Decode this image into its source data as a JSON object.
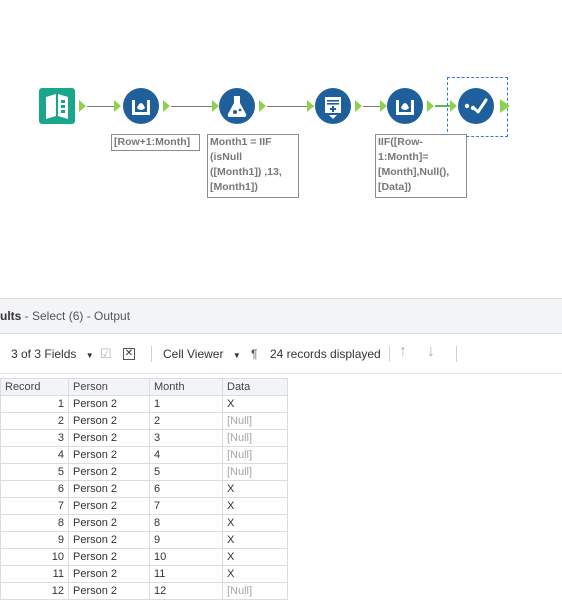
{
  "workflow": {
    "annotations": {
      "multi_row_1": "[Row+1:Month]",
      "formula": "Month1 = IIF\n(isNull\n([Month1]) ,13,\n[Month1])",
      "multi_row_2": "IIF([Row-\n1:Month]=\n[Month],Null(),\n[Data])"
    }
  },
  "results": {
    "title": "ults",
    "subtitle": " - Select (6) - Output"
  },
  "toolbar": {
    "fields_label": "3 of 3 Fields",
    "cell_viewer_label": "Cell Viewer",
    "records_label": "24 records displayed"
  },
  "table": {
    "columns": [
      "Record",
      "Person",
      "Month",
      "Data"
    ],
    "rows": [
      [
        "1",
        "Person 2",
        "1",
        "X"
      ],
      [
        "2",
        "Person 2",
        "2",
        "[Null]"
      ],
      [
        "3",
        "Person 2",
        "3",
        "[Null]"
      ],
      [
        "4",
        "Person 2",
        "4",
        "[Null]"
      ],
      [
        "5",
        "Person 2",
        "5",
        "[Null]"
      ],
      [
        "6",
        "Person 2",
        "6",
        "X"
      ],
      [
        "7",
        "Person 2",
        "7",
        "X"
      ],
      [
        "8",
        "Person 2",
        "8",
        "X"
      ],
      [
        "9",
        "Person 2",
        "9",
        "X"
      ],
      [
        "10",
        "Person 2",
        "10",
        "X"
      ],
      [
        "11",
        "Person 2",
        "11",
        "X"
      ],
      [
        "12",
        "Person 2",
        "12",
        "[Null]"
      ]
    ]
  }
}
